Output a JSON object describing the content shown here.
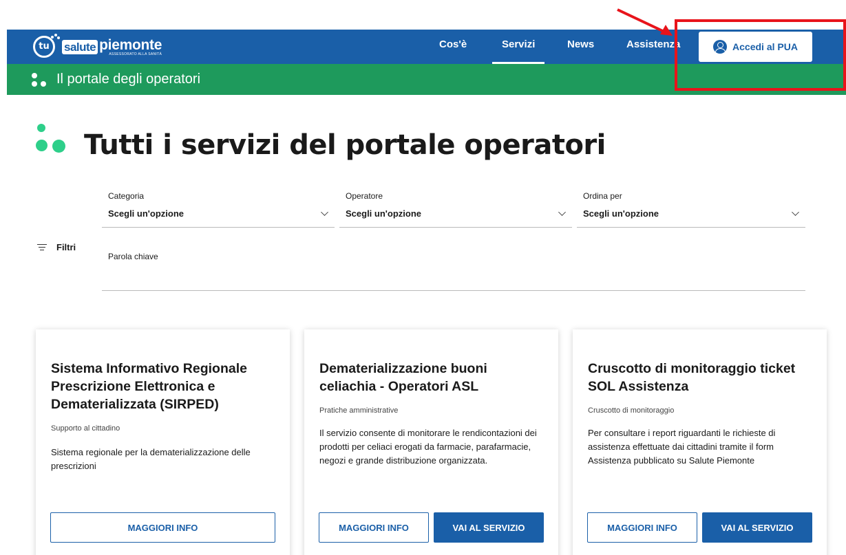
{
  "header": {
    "logo_tu": "tu",
    "logo_salute": "salute",
    "logo_piemonte": "piemonte",
    "logo_sub": "ASSESSORATO ALLA SANITÀ",
    "nav": [
      "Cos'è",
      "Servizi",
      "News",
      "Assistenza"
    ],
    "active_nav": "Servizi",
    "login_label": "Accedi al PUA",
    "login_icon": "user-circle-icon"
  },
  "strip": {
    "label": "Il portale degli operatori"
  },
  "page": {
    "title": "Tutti i servizi del portale operatori"
  },
  "filters": {
    "categoria": {
      "label": "Categoria",
      "value": "Scegli un'opzione"
    },
    "operatore": {
      "label": "Operatore",
      "value": "Scegli un'opzione"
    },
    "ordina": {
      "label": "Ordina per",
      "value": "Scegli un'opzione"
    },
    "filtri_label": "Filtri",
    "keyword_placeholder": "Parola chiave"
  },
  "cards": [
    {
      "title": "Sistema Informativo Regionale Prescrizione Elettronica e Dematerializzata (SIRPED)",
      "category": "Supporto al cittadino",
      "description": "Sistema regionale per la dematerializzazione delle prescrizioni",
      "info_label": "MAGGIORI INFO"
    },
    {
      "title": "Dematerializzazione buoni celiachia - Operatori ASL",
      "category": "Pratiche amministrative",
      "description": "Il servizio consente di monitorare le rendicontazioni dei prodotti per celiaci erogati da farmacie, parafarmacie, negozi e grande distribuzione organizzata.",
      "info_label": "MAGGIORI INFO",
      "service_label": "VAI AL SERVIZIO"
    },
    {
      "title": "Cruscotto di monitoraggio ticket SOL Assistenza",
      "category": "Cruscotto di monitoraggio",
      "description": "Per consultare i report riguardanti le richieste di assistenza effettuate dai cittadini tramite il form Assistenza pubblicato su Salute Piemonte",
      "info_label": "MAGGIORI INFO",
      "service_label": "VAI AL SERVIZIO"
    }
  ],
  "colors": {
    "brand_blue": "#1a5fa8",
    "brand_green": "#1e9a5c",
    "accent_green": "#2ecf8a",
    "annotation_red": "#e8141b"
  }
}
